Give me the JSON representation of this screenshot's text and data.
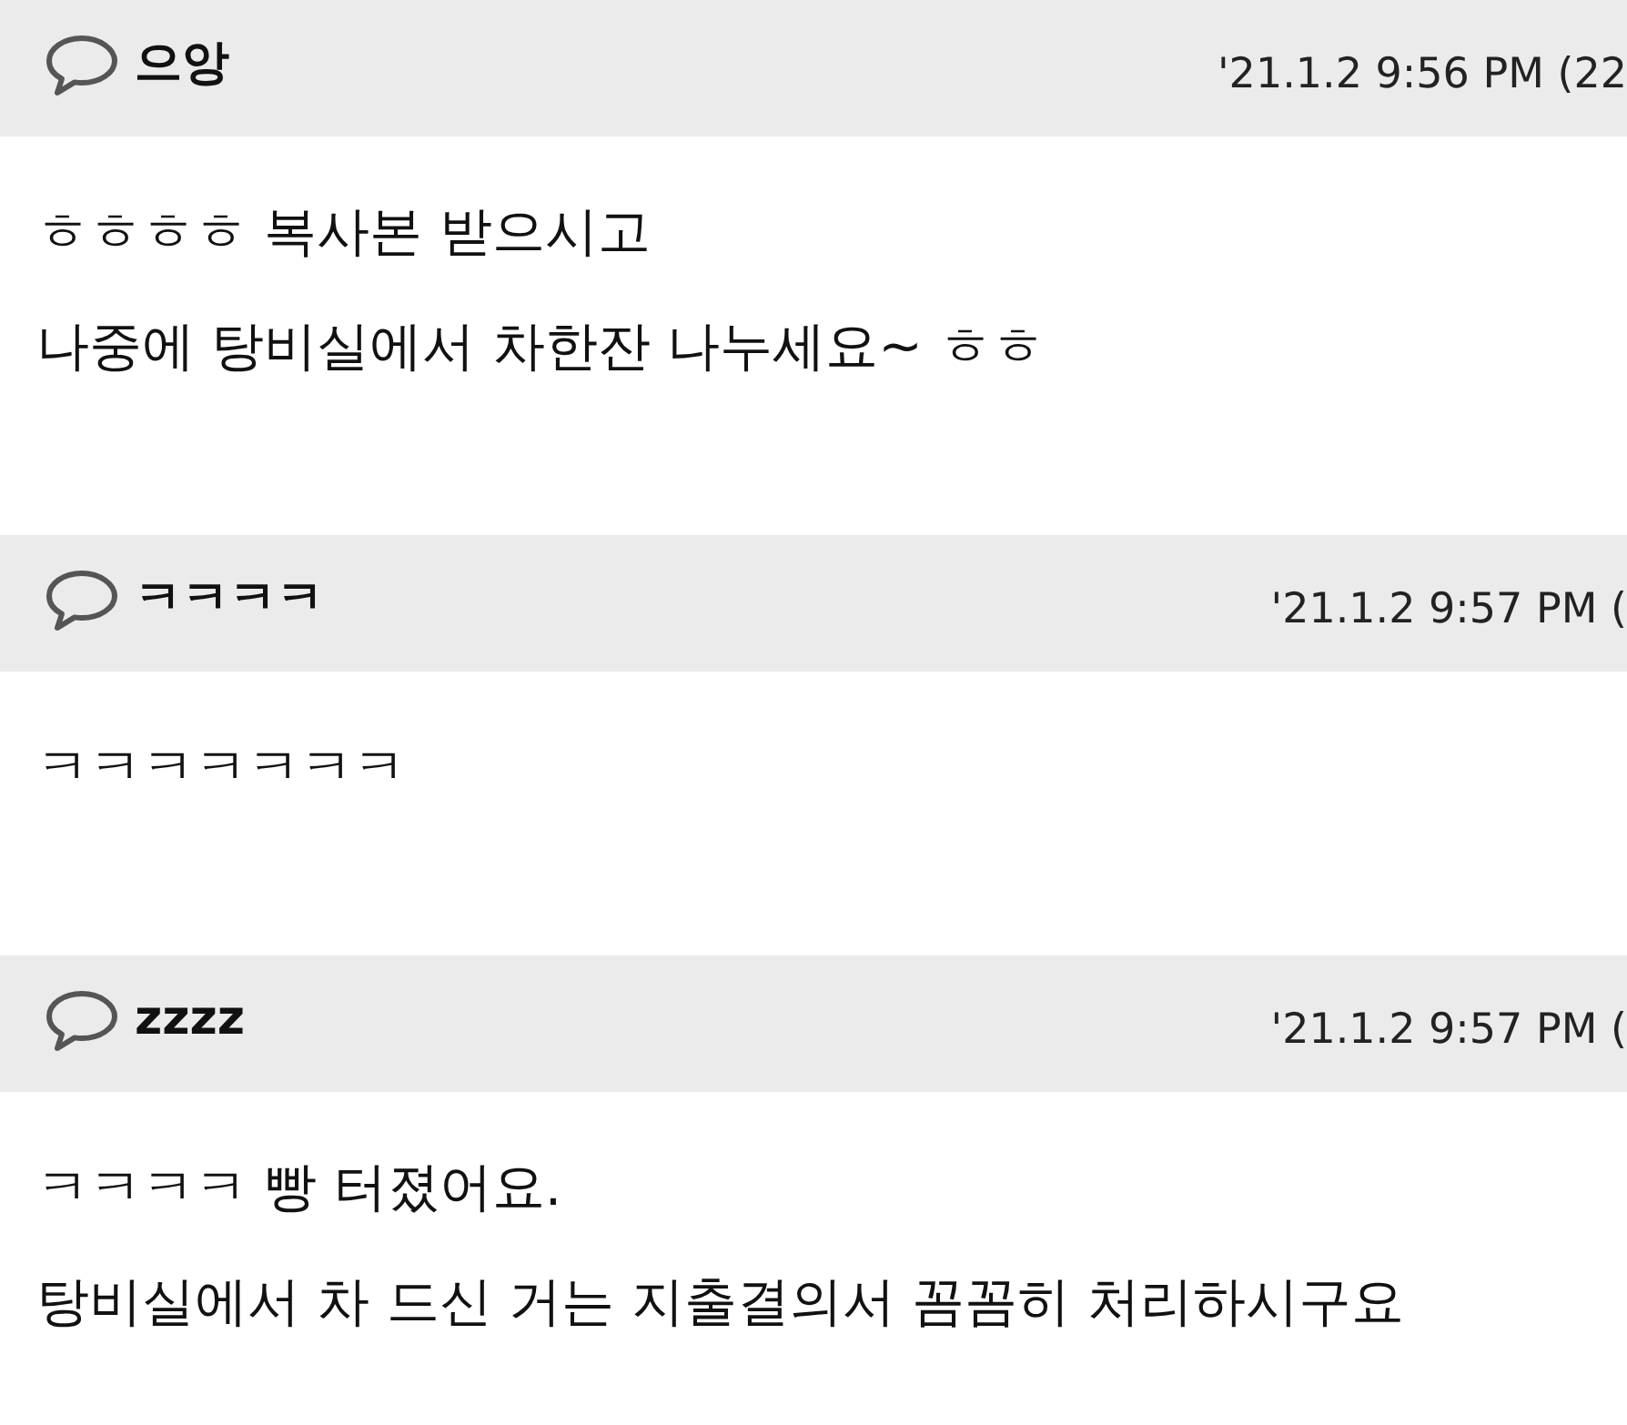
{
  "comments": [
    {
      "author": "으앙",
      "time": "'21.1.2 9:56 PM (22",
      "lines": [
        "ㅎㅎㅎㅎ 복사본 받으시고",
        "나중에 탕비실에서 차한잔 나누세요~ ㅎㅎ"
      ]
    },
    {
      "author": "ㅋㅋㅋㅋ",
      "time": "'21.1.2 9:57 PM (",
      "lines": [
        "ㅋㅋㅋㅋㅋㅋㅋ"
      ]
    },
    {
      "author": "zzzz",
      "time": "'21.1.2 9:57 PM (",
      "lines": [
        "ㅋㅋㅋㅋ 빵 터졌어요.",
        "탕비실에서 차 드신 거는 지출결의서 꼼꼼히 처리하시구요"
      ]
    }
  ]
}
